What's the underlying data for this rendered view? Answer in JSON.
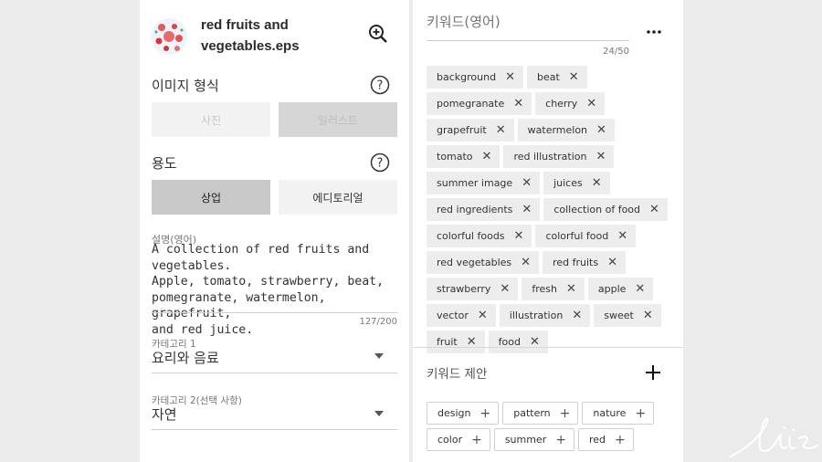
{
  "file": {
    "name": "red fruits and vegetables.eps"
  },
  "image_type": {
    "label": "이미지 형식",
    "options": [
      {
        "label": "사진",
        "state": "disabled"
      },
      {
        "label": "일러스트",
        "state": "selected"
      }
    ]
  },
  "usage": {
    "label": "용도",
    "options": [
      {
        "label": "상업",
        "state": "selected"
      },
      {
        "label": "에디토리얼",
        "state": "normal"
      }
    ]
  },
  "description": {
    "label": "설명(영어)",
    "value": "A collection of red fruits and vegetables.\nApple, tomato, strawberry, beat,\npomegranate, watermelon, grapefruit,\nand red juice.",
    "counter": "127/200"
  },
  "category1": {
    "label": "카테고리 1",
    "value": "요리와 음료"
  },
  "category2": {
    "label": "카테고리 2(선택 사항)",
    "value": "자연"
  },
  "keywords": {
    "placeholder": "키워드(영어)",
    "counter": "24/50",
    "more_icon": "more-horizontal-icon",
    "items": [
      "background",
      "beat",
      "pomegranate",
      "cherry",
      "grapefruit",
      "watermelon",
      "tomato",
      "red illustration",
      "summer image",
      "juices",
      "red ingredients",
      "collection of food",
      "colorful foods",
      "colorful food",
      "red vegetables",
      "red fruits",
      "strawberry",
      "fresh",
      "apple",
      "vector",
      "illustration",
      "sweet",
      "fruit",
      "food"
    ]
  },
  "suggestions": {
    "title": "키워드 제안",
    "items": [
      "design",
      "pattern",
      "nature",
      "color",
      "summer",
      "red"
    ]
  },
  "colors": {
    "selected_button": "#c8c8c8",
    "disabled_button": "#f0f0f0",
    "tag_bg": "#ededed",
    "panel_bg": "#ffffff",
    "page_bg": "#ebebeb"
  }
}
